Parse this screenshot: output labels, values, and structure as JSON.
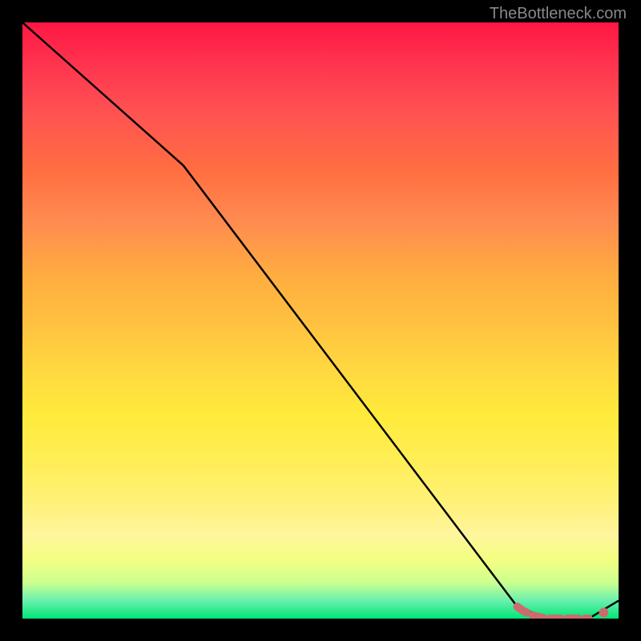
{
  "watermark": "TheBottleneck.com",
  "chart_data": {
    "type": "line",
    "title": "",
    "xlabel": "",
    "ylabel": "",
    "xlim": [
      0,
      100
    ],
    "ylim": [
      0,
      100
    ],
    "series": [
      {
        "name": "curve",
        "color": "#000000",
        "x": [
          0,
          27,
          83,
          88,
          95,
          100
        ],
        "y": [
          100,
          76,
          2,
          0,
          0,
          3
        ]
      }
    ],
    "markers": [
      {
        "x": 83,
        "y": 2,
        "color": "#d76565"
      },
      {
        "x": 84.5,
        "y": 1,
        "color": "#d76565"
      },
      {
        "x": 86,
        "y": 0.5,
        "color": "#d76565"
      },
      {
        "x": 88,
        "y": 0,
        "color": "#d76565"
      },
      {
        "x": 90,
        "y": 0,
        "color": "#d76565"
      },
      {
        "x": 92,
        "y": 0,
        "color": "#d76565"
      },
      {
        "x": 94,
        "y": 0,
        "color": "#d76565"
      },
      {
        "x": 97,
        "y": 1,
        "color": "#d76565"
      }
    ],
    "background_gradient": {
      "top": "#ff1744",
      "middle": "#ffeb3b",
      "bottom": "#00e676"
    }
  }
}
